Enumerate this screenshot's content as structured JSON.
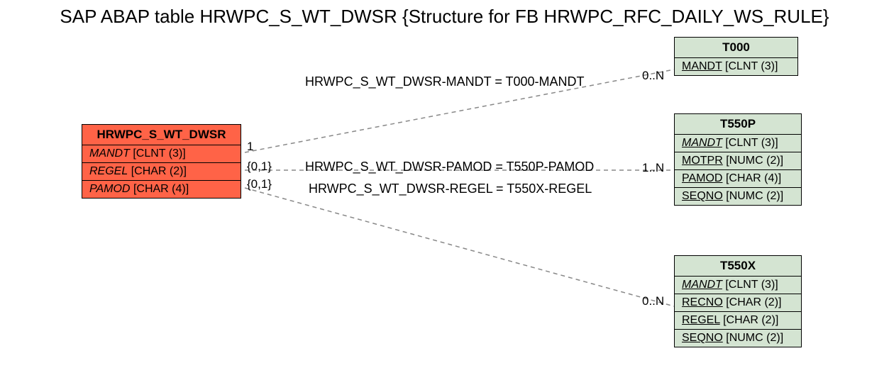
{
  "title": "SAP ABAP table HRWPC_S_WT_DWSR {Structure for FB HRWPC_RFC_DAILY_WS_RULE}",
  "main_entity": {
    "name": "HRWPC_S_WT_DWSR",
    "fields": [
      {
        "name": "MANDT",
        "type": "[CLNT (3)]",
        "key": true,
        "italic": true
      },
      {
        "name": "REGEL",
        "type": "[CHAR (2)]",
        "key": false,
        "italic": true
      },
      {
        "name": "PAMOD",
        "type": "[CHAR (4)]",
        "key": false,
        "italic": true
      }
    ]
  },
  "related_entities": [
    {
      "name": "T000",
      "fields": [
        {
          "name": "MANDT",
          "type": "[CLNT (3)]",
          "key": true,
          "italic": false
        }
      ]
    },
    {
      "name": "T550P",
      "fields": [
        {
          "name": "MANDT",
          "type": "[CLNT (3)]",
          "key": true,
          "italic": true
        },
        {
          "name": "MOTPR",
          "type": "[NUMC (2)]",
          "key": true,
          "italic": false
        },
        {
          "name": "PAMOD",
          "type": "[CHAR (4)]",
          "key": true,
          "italic": false
        },
        {
          "name": "SEQNO",
          "type": "[NUMC (2)]",
          "key": true,
          "italic": false
        }
      ]
    },
    {
      "name": "T550X",
      "fields": [
        {
          "name": "MANDT",
          "type": "[CLNT (3)]",
          "key": true,
          "italic": true
        },
        {
          "name": "RECNO",
          "type": "[CHAR (2)]",
          "key": true,
          "italic": false
        },
        {
          "name": "REGEL",
          "type": "[CHAR (2)]",
          "key": true,
          "italic": false
        },
        {
          "name": "SEQNO",
          "type": "[NUMC (2)]",
          "key": true,
          "italic": false
        }
      ]
    }
  ],
  "relations": [
    {
      "label": "HRWPC_S_WT_DWSR-MANDT = T000-MANDT",
      "left_card": "1",
      "right_card": "0..N"
    },
    {
      "label": "HRWPC_S_WT_DWSR-PAMOD = T550P-PAMOD",
      "left_card": "{0,1}",
      "right_card": "1..N"
    },
    {
      "label": "HRWPC_S_WT_DWSR-REGEL = T550X-REGEL",
      "left_card": "{0,1}",
      "right_card": "0..N"
    }
  ],
  "chart_data": {
    "type": "table",
    "title": "E-R diagram for SAP ABAP table HRWPC_S_WT_DWSR",
    "entities": [
      {
        "name": "HRWPC_S_WT_DWSR",
        "fields": [
          "MANDT CLNT(3)",
          "REGEL CHAR(2)",
          "PAMOD CHAR(4)"
        ]
      },
      {
        "name": "T000",
        "fields": [
          "MANDT CLNT(3)"
        ]
      },
      {
        "name": "T550P",
        "fields": [
          "MANDT CLNT(3)",
          "MOTPR NUMC(2)",
          "PAMOD CHAR(4)",
          "SEQNO NUMC(2)"
        ]
      },
      {
        "name": "T550X",
        "fields": [
          "MANDT CLNT(3)",
          "RECNO CHAR(2)",
          "REGEL CHAR(2)",
          "SEQNO NUMC(2)"
        ]
      }
    ],
    "relationships": [
      {
        "from": "HRWPC_S_WT_DWSR.MANDT",
        "to": "T000.MANDT",
        "left": "1",
        "right": "0..N"
      },
      {
        "from": "HRWPC_S_WT_DWSR.PAMOD",
        "to": "T550P.PAMOD",
        "left": "{0,1}",
        "right": "1..N"
      },
      {
        "from": "HRWPC_S_WT_DWSR.REGEL",
        "to": "T550X.REGEL",
        "left": "{0,1}",
        "right": "0..N"
      }
    ]
  }
}
